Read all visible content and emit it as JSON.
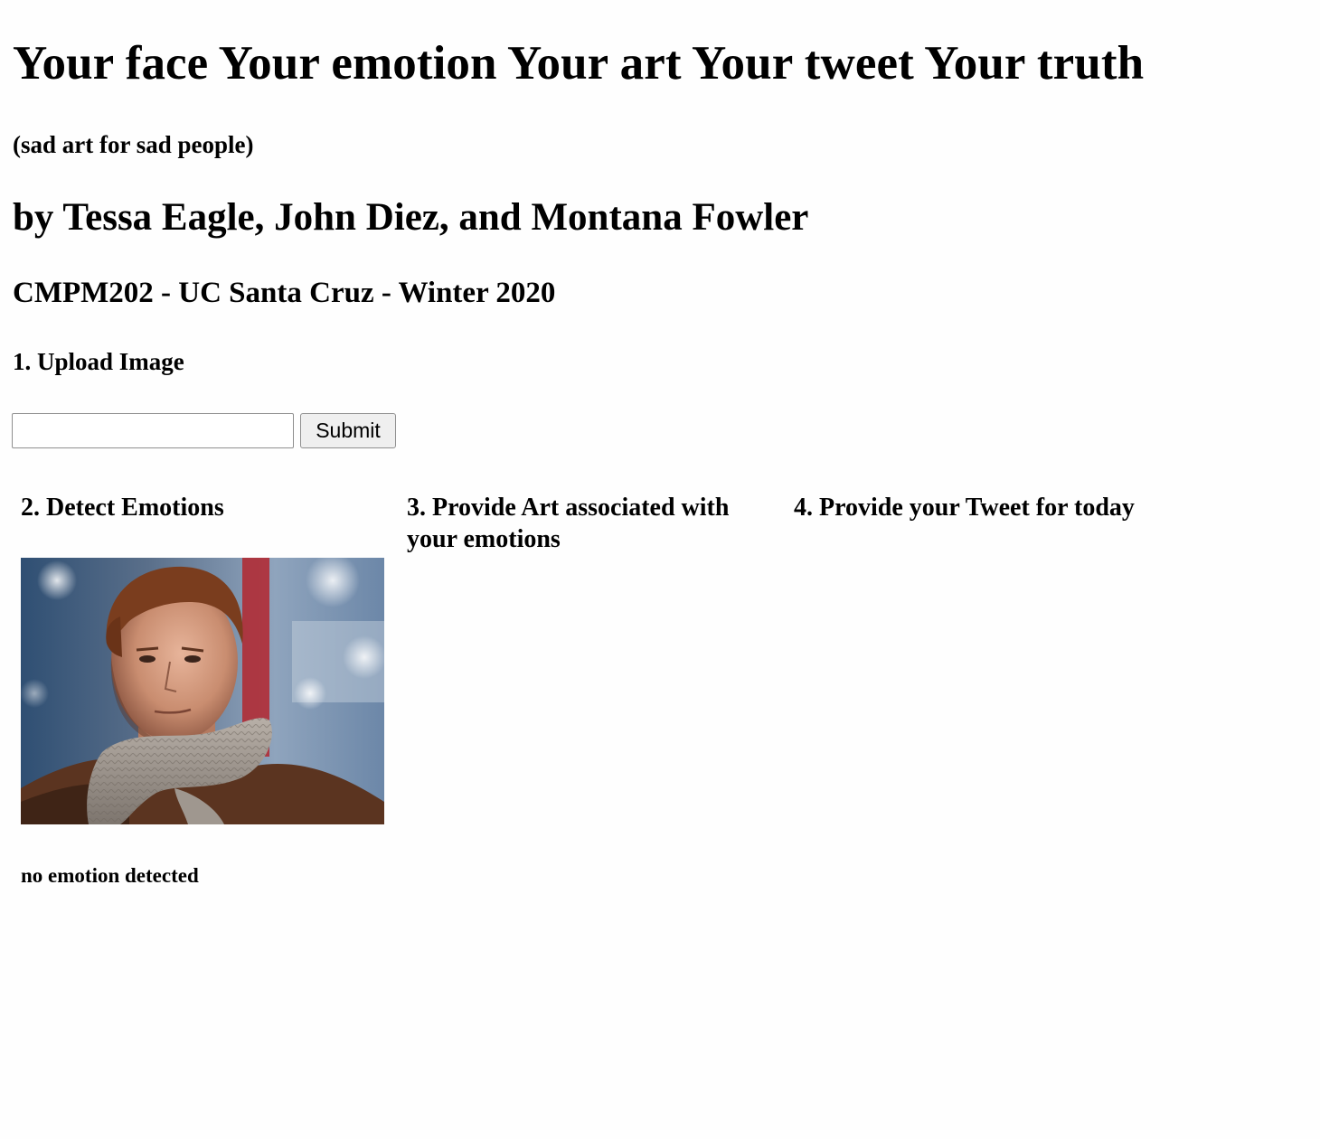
{
  "header": {
    "title": "Your face Your emotion Your art Your tweet Your truth",
    "subtitle": "(sad art for sad people)",
    "authors": "by Tessa Eagle, John Diez, and Montana Fowler",
    "course": "CMPM202 - UC Santa Cruz - Winter 2020"
  },
  "upload": {
    "heading": "1. Upload Image",
    "input_value": "",
    "input_placeholder": "",
    "submit_label": "Submit"
  },
  "steps": {
    "detect": {
      "heading": "2. Detect Emotions",
      "result": "no emotion detected"
    },
    "art": {
      "heading": "3. Provide Art associated with your emotions"
    },
    "tweet": {
      "heading": "4. Provide your Tweet for today"
    }
  }
}
